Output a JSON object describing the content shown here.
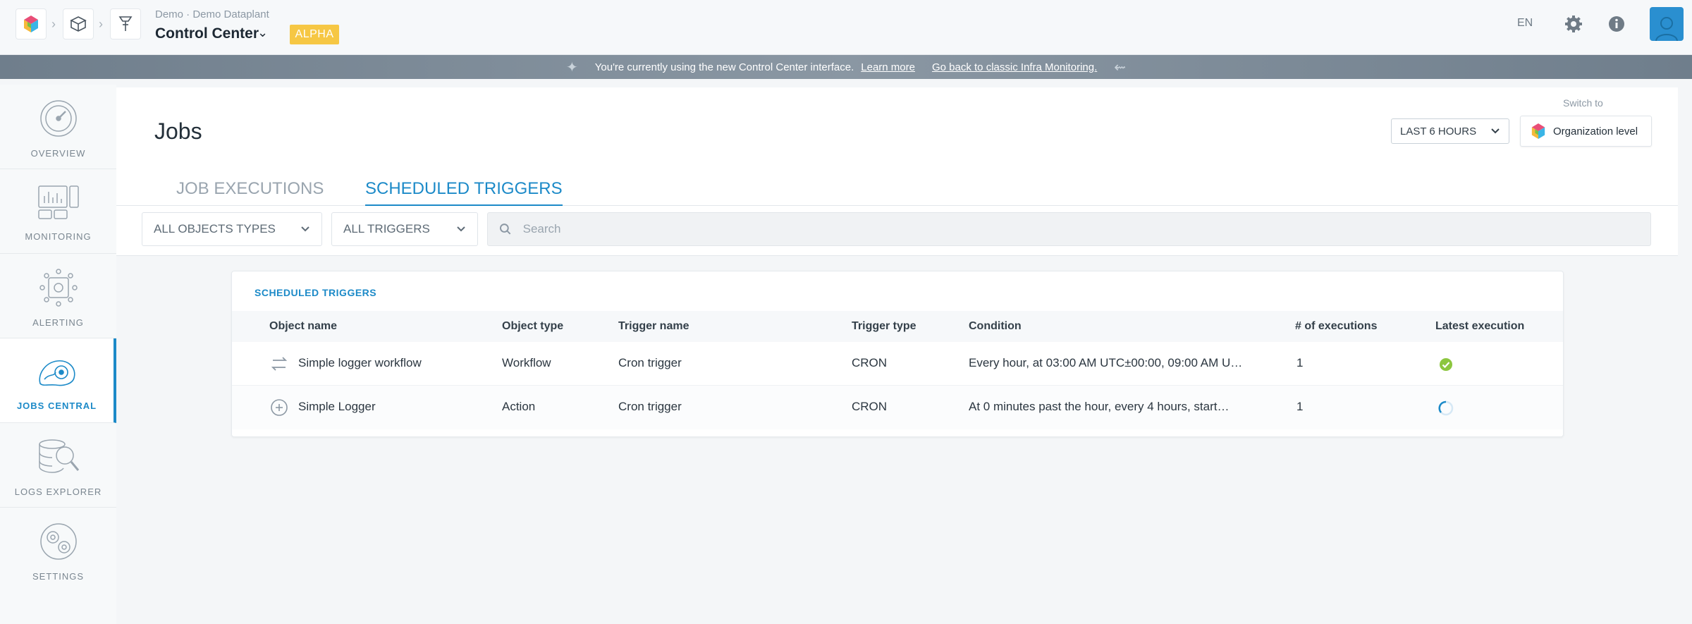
{
  "topbar": {
    "path": "Demo · Demo Dataplant",
    "title": "Control Center",
    "badge": "ALPHA",
    "language": "EN",
    "icons": [
      "logo-icon",
      "cube-icon",
      "pipeline-icon",
      "gear-icon",
      "info-icon",
      "user-avatar-icon"
    ]
  },
  "banner": {
    "text": "You're currently using the new Control Center interface.",
    "learn_more": "Learn more",
    "go_back": "Go back to classic Infra Monitoring."
  },
  "sidebar": {
    "items": [
      {
        "label": "OVERVIEW",
        "icon": "gauge-icon",
        "active": false
      },
      {
        "label": "MONITORING",
        "icon": "monitoring-icon",
        "active": false
      },
      {
        "label": "ALERTING",
        "icon": "alerting-icon",
        "active": false
      },
      {
        "label": "JOBS CENTRAL",
        "icon": "jobs-icon",
        "active": true
      },
      {
        "label": "LOGS EXPLORER",
        "icon": "logs-icon",
        "active": false
      },
      {
        "label": "SETTINGS",
        "icon": "settings-icon",
        "active": false
      }
    ]
  },
  "main": {
    "title": "Jobs",
    "switch_label": "Switch to",
    "range_button": "LAST 6 HOURS",
    "org_button": "Organization level",
    "tabs": [
      {
        "label": "JOB EXECUTIONS",
        "active": false
      },
      {
        "label": "SCHEDULED TRIGGERS",
        "active": true
      }
    ],
    "filters": {
      "object_types": "ALL OBJECTS TYPES",
      "triggers": "ALL TRIGGERS",
      "search_placeholder": "Search"
    }
  },
  "table": {
    "title": "SCHEDULED TRIGGERS",
    "columns": [
      "Object name",
      "Object type",
      "Trigger name",
      "Trigger type",
      "Condition",
      "# of executions",
      "Latest execution"
    ],
    "rows": [
      {
        "icon": "workflow-icon",
        "object_name": "Simple logger workflow",
        "object_type": "Workflow",
        "trigger_name": "Cron trigger",
        "trigger_type": "CRON",
        "condition": "Every hour, at 03:00 AM UTC±00:00, 09:00 AM U…",
        "executions": "1",
        "latest": "success"
      },
      {
        "icon": "action-icon",
        "object_name": "Simple Logger",
        "object_type": "Action",
        "trigger_name": "Cron trigger",
        "trigger_type": "CRON",
        "condition": "At 0 minutes past the hour, every 4 hours, start…",
        "executions": "1",
        "latest": "running"
      }
    ]
  },
  "colors": {
    "accent": "#1c8ac8",
    "badge": "#f6c744",
    "success": "#8cc63f",
    "banner": "#7d8a96"
  }
}
